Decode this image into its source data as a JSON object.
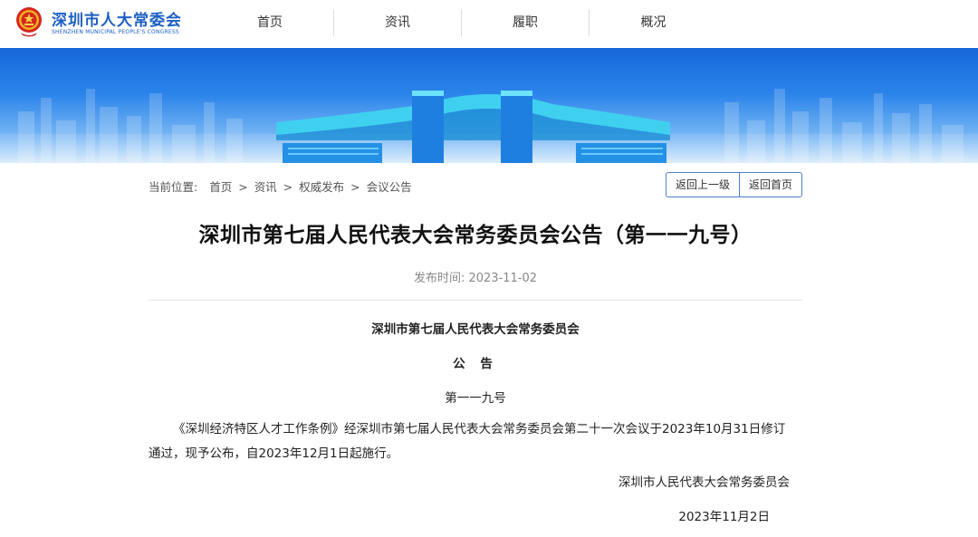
{
  "header": {
    "brand_cn": "深圳市人大常委会",
    "brand_en": "SHENZHEN MUNICIPAL PEOPLE'S CONGRESS",
    "nav": [
      "首页",
      "资讯",
      "履职",
      "概况"
    ]
  },
  "breadcrumb": {
    "prefix": "当前位置:",
    "items": [
      "首页",
      "资讯",
      "权威发布",
      "会议公告"
    ],
    "separator": ">"
  },
  "buttons": {
    "back_up": "返回上一级",
    "back_home": "返回首页"
  },
  "article": {
    "title": "深圳市第七届人民代表大会常务委员会公告（第一一九号）",
    "publish_label": "发布时间:",
    "publish_date": "2023-11-02",
    "issuer": "深圳市第七届人民代表大会常务委员会",
    "doc_type": "公 告",
    "number": "第一一九号",
    "body": "《深圳经济特区人才工作条例》经深圳市第七届人民代表大会常务委员会第二十一次会议于2023年10月31日修订通过，现予公布，自2023年12月1日起施行。",
    "signature": "深圳市人民代表大会常务委员会",
    "sign_date": "2023年11月2日"
  },
  "colors": {
    "brand": "#1c5fc4",
    "banner": "#2b84ea",
    "button_border": "#4c7fc7"
  },
  "icons": {
    "logo": "national-emblem-icon"
  }
}
